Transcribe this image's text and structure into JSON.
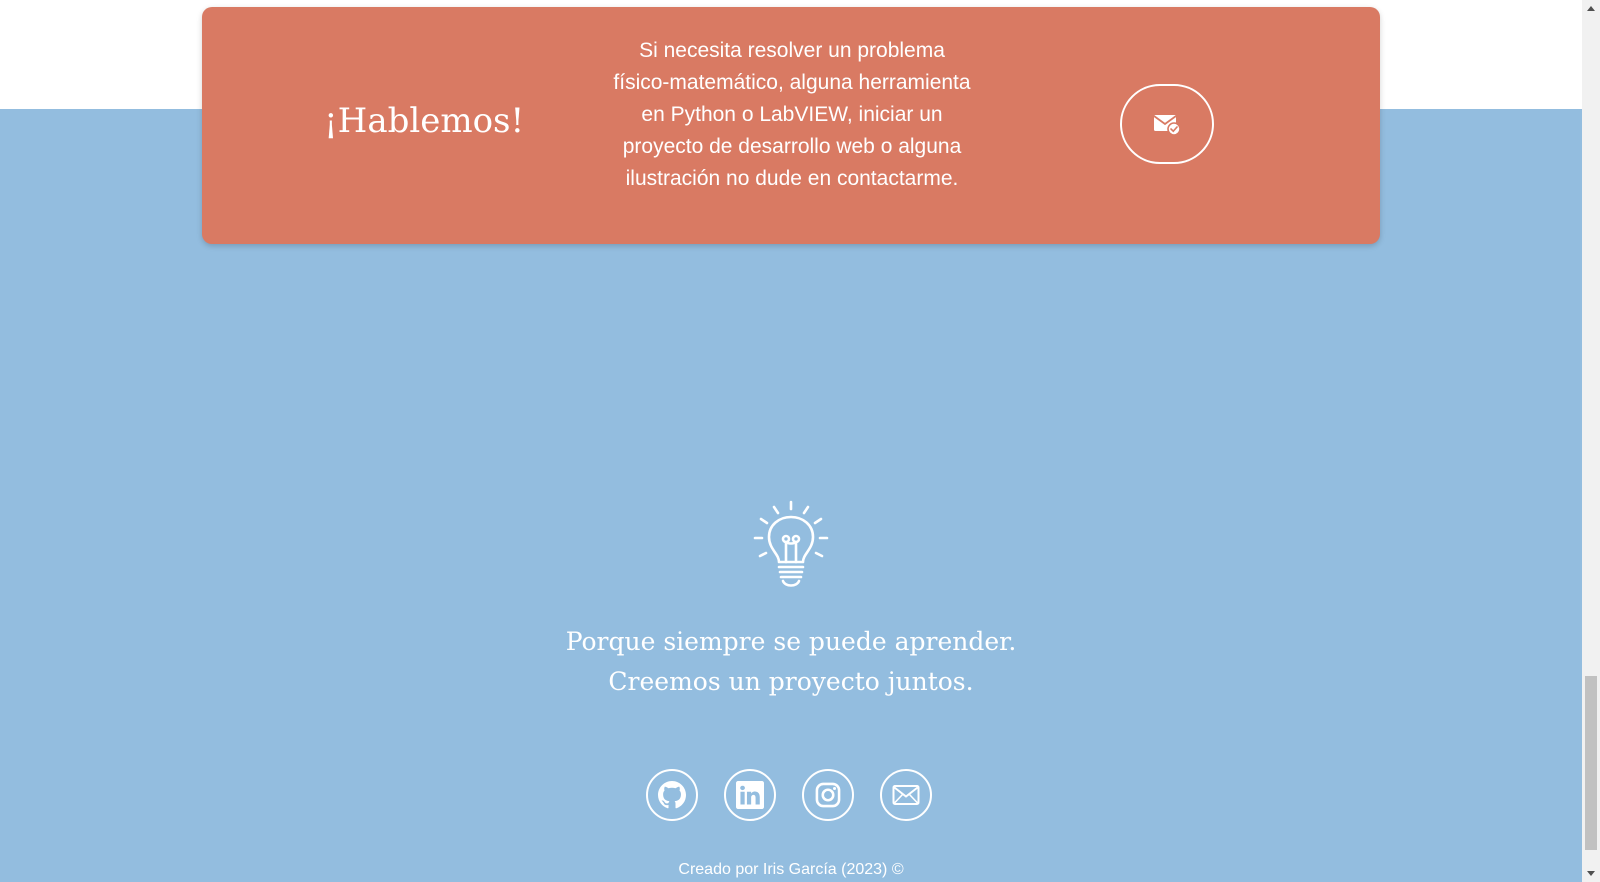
{
  "cta": {
    "title": "¡Hablemos!",
    "text": "Si necesita resolver un problema físico-matemático, alguna herramienta en Python o LabVIEW, iniciar un proyecto de desarrollo web o alguna ilustración no dude en contactarme.",
    "button_icon": "mail-check-icon"
  },
  "hero": {
    "icon": "lightbulb-icon",
    "tagline_line1": "Porque siempre se puede aprender.",
    "tagline_line2": "Creemos un proyecto juntos."
  },
  "socials": [
    {
      "icon": "github-icon"
    },
    {
      "icon": "linkedin-icon"
    },
    {
      "icon": "instagram-icon"
    },
    {
      "icon": "mail-icon"
    }
  ],
  "footer": {
    "credit": "Creado por Iris García (2023) ©"
  },
  "colors": {
    "cta_background": "#d97a63",
    "footer_background": "#93bddf",
    "text": "#ffffff"
  }
}
